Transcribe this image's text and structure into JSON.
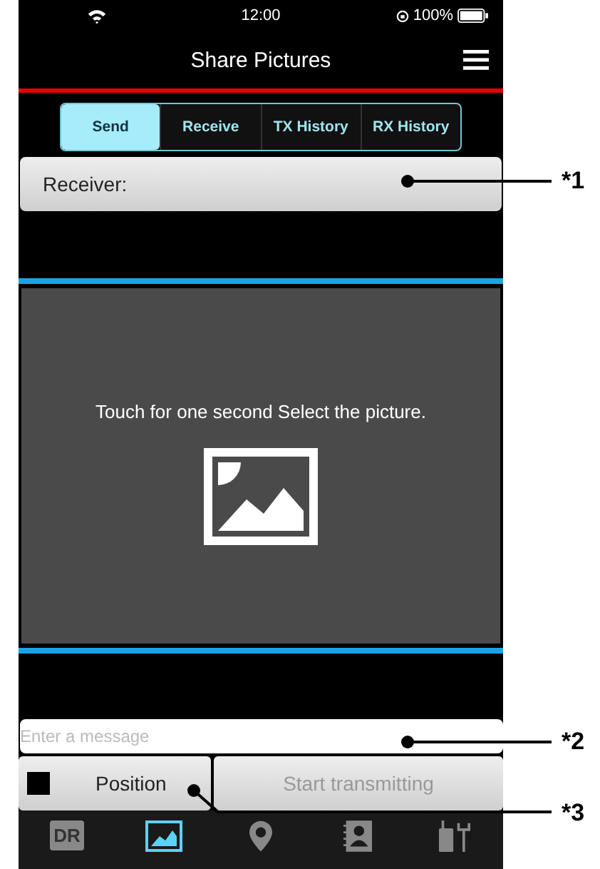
{
  "status_bar": {
    "time": "12:00",
    "battery": "100%"
  },
  "header": {
    "title": "Share Pictures"
  },
  "tabs": [
    {
      "label": "Send",
      "selected": true
    },
    {
      "label": "Receive",
      "selected": false
    },
    {
      "label": "TX History",
      "selected": false
    },
    {
      "label": "RX History",
      "selected": false
    }
  ],
  "receiver": {
    "label": "Receiver:"
  },
  "picture_area": {
    "hint": "Touch for one second Select the picture.",
    "selected": true
  },
  "message": {
    "placeholder": "Enter a message"
  },
  "position": {
    "label": "Position",
    "checked": false
  },
  "transmit": {
    "label": "Start transmitting",
    "disabled": true
  },
  "bottom_tabs": [
    {
      "kind": "dr",
      "icon_text": "DR",
      "selected": false
    },
    {
      "kind": "picture",
      "selected": true
    },
    {
      "kind": "pin",
      "selected": false
    },
    {
      "kind": "contacts",
      "selected": false
    },
    {
      "kind": "radio",
      "selected": false
    }
  ],
  "callouts": [
    {
      "label": "*1",
      "kind": "receiver"
    },
    {
      "label": "*2",
      "kind": "message"
    },
    {
      "label": "*3",
      "kind": "position"
    }
  ]
}
